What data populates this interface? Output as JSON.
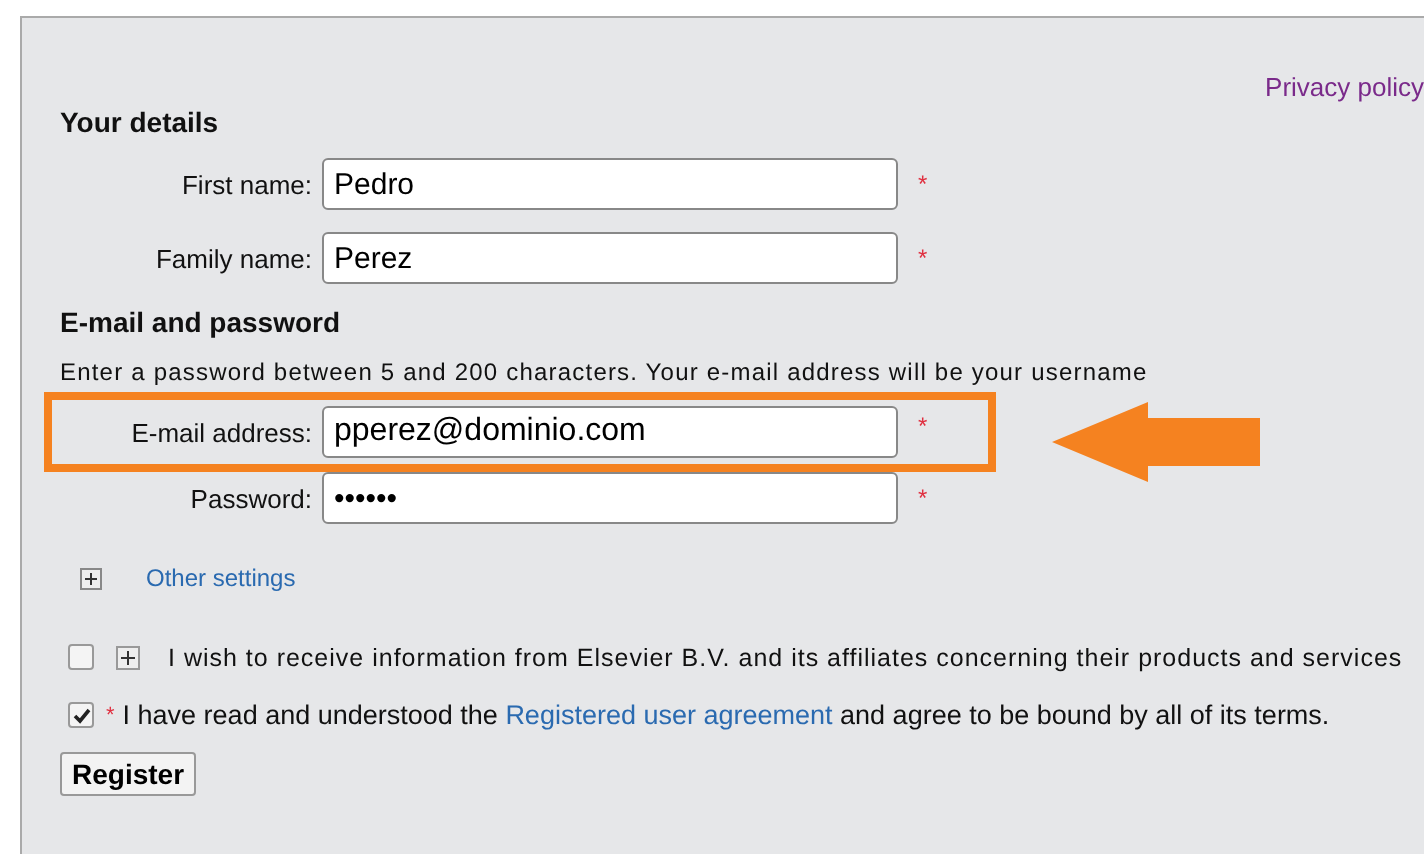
{
  "privacy_link": "Privacy policy",
  "sections": [
    {
      "title": "Your details",
      "fields": [
        {
          "label": "First name:",
          "value": "Pedro",
          "required_mark": "*",
          "highlighted": false
        },
        {
          "label": "Family name:",
          "value": "Perez",
          "required_mark": "*",
          "highlighted": false
        }
      ]
    },
    {
      "title": "E-mail and password",
      "hint": "Enter a password between 5 and 200 characters. Your e-mail address will be your username",
      "fields": [
        {
          "label": "E-mail address:",
          "value": "pperez@dominio.com",
          "required_mark": "*",
          "highlighted": true
        },
        {
          "label": "Password:",
          "value": "••••••",
          "required_mark": "*",
          "highlighted": false
        }
      ]
    }
  ],
  "other_settings": {
    "label": "Other settings",
    "expanded": false
  },
  "options": [
    {
      "kind": "info",
      "checked": false,
      "text": "I wish to receive information from Elsevier B.V. and its affiliates concerning their products and services"
    },
    {
      "kind": "agreement",
      "checked": true,
      "required_mark": "*",
      "text_before": "I have read and understood the",
      "link": "Registered user agreement",
      "text_after": "and agree to be bound by all of its terms."
    }
  ],
  "buttons": [
    "Register"
  ]
}
